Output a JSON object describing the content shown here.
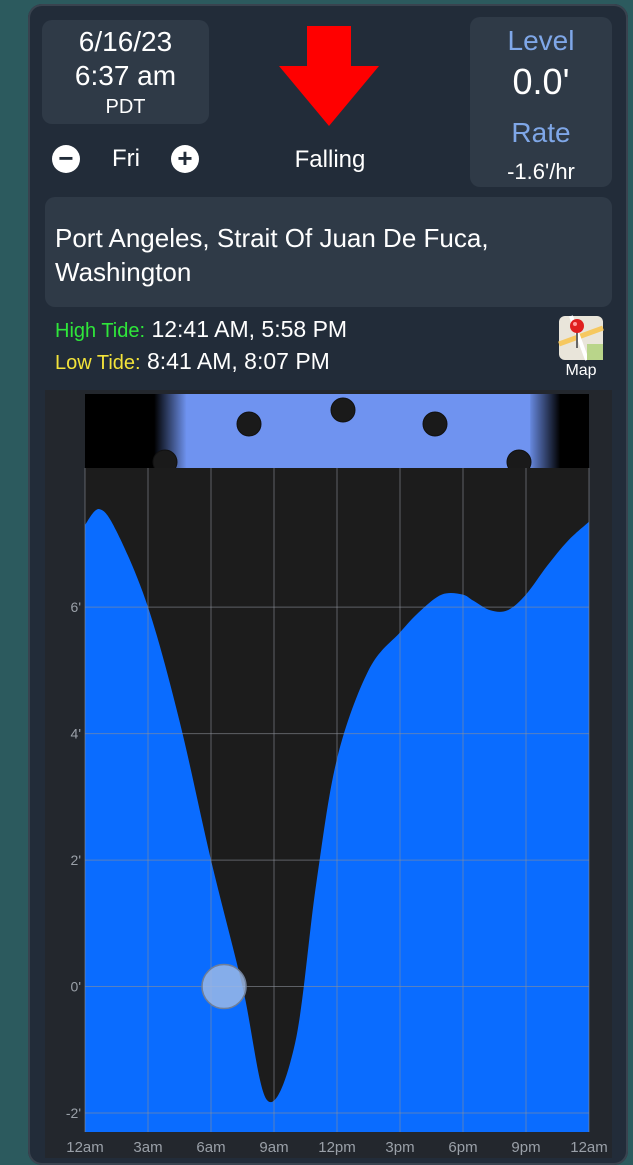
{
  "header": {
    "date": "6/16/23",
    "time": "6:37 am",
    "timezone": "PDT",
    "day": "Fri",
    "trend": "Falling",
    "arrow_color": "#ff0000"
  },
  "level": {
    "label": "Level",
    "value": "0.0'"
  },
  "rate": {
    "label": "Rate",
    "value": "-1.6'/hr"
  },
  "location": {
    "name": "Port Angeles, Strait Of Juan De Fuca, Washington"
  },
  "tides": {
    "high_label": "High Tide:",
    "high_times": "12:41 AM, 5:58 PM",
    "low_label": "Low Tide:",
    "low_times": "8:41 AM, 8:07 PM"
  },
  "map": {
    "label": "Map",
    "icon": "map-pin-icon"
  },
  "colors": {
    "water": "#0a6cff",
    "chart_bg": "#1c1c1c",
    "daylight": "#6f93f0",
    "accent": "#7fa7e8"
  },
  "chart_data": {
    "type": "area",
    "x_tick_labels": [
      "12am",
      "3am",
      "6am",
      "9am",
      "12pm",
      "3pm",
      "6pm",
      "9pm",
      "12am"
    ],
    "y_tick_labels": [
      "-2'",
      "0'",
      "2'",
      "4'",
      "6'"
    ],
    "x_hours": [
      0,
      0.68,
      1.5,
      3,
      4.5,
      6,
      7.5,
      8.68,
      10,
      11,
      12,
      13.5,
      15,
      16,
      17,
      17.97,
      18.5,
      19.3,
      20.12,
      21,
      22,
      23,
      24
    ],
    "y_feet": [
      7.3,
      7.55,
      7.2,
      6.0,
      4.2,
      2.0,
      0.0,
      -1.8,
      -0.9,
      1.6,
      3.6,
      5.0,
      5.6,
      5.95,
      6.2,
      6.2,
      6.1,
      5.95,
      5.95,
      6.2,
      6.65,
      7.05,
      7.35
    ],
    "ylim": [
      -2.3,
      8.2
    ],
    "xlim": [
      0,
      24
    ],
    "current": {
      "hour": 6.62,
      "feet": 0.0
    },
    "sunrise_hour": 5.2,
    "sunset_hour": 21.2,
    "grid": true
  }
}
